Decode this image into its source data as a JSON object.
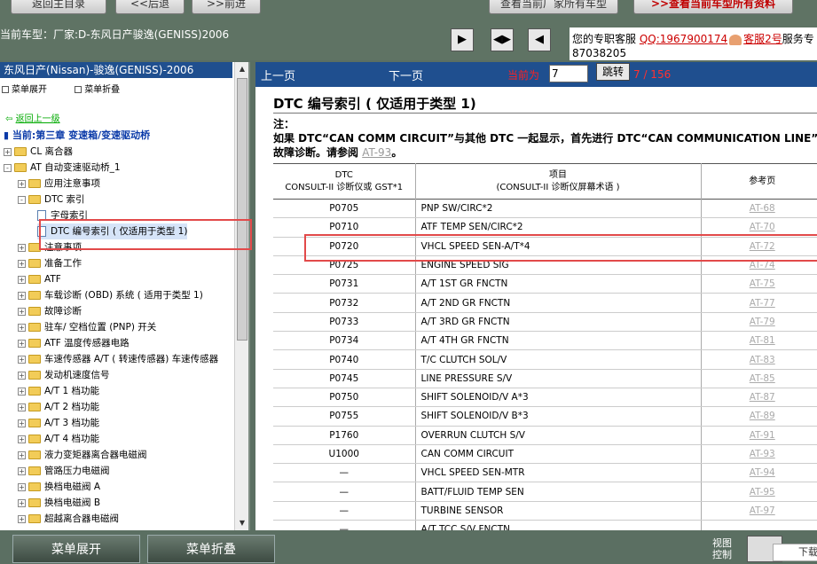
{
  "topbar": {
    "buttons": [
      "返回主目录",
      "<<后退",
      ">>前进",
      "查看当前厂家所有车型",
      ">>查看当前车型所有资料"
    ],
    "current_model": "当前车型：厂家:D-东风日产骏逸(GENISS)2006",
    "nav_icons": [
      "panel-right-icon",
      "panel-split-icon",
      "panel-left-icon"
    ],
    "service_text": "您的专职客服",
    "qq": "QQ:1967900174",
    "service2": "客服2号",
    "service_suffix": "服务专",
    "phone": "87038205"
  },
  "sidebar": {
    "title": "东风日产(Nissan)-骏逸(GENISS)-2006",
    "expand_all": "菜单展开",
    "collapse_all": "菜单折叠",
    "back_up": "返回上一级",
    "current_chapter": "当前:第三章 变速箱/变速驱动桥",
    "tree": [
      {
        "label": "CL 离合器",
        "level": 0,
        "exp": "+"
      },
      {
        "label": "AT 自动变速驱动桥_1",
        "level": 0,
        "exp": "-"
      },
      {
        "label": "应用注意事项",
        "level": 1,
        "exp": "+"
      },
      {
        "label": "DTC 索引",
        "level": 1,
        "exp": "-"
      },
      {
        "label": "字母索引",
        "level": 2,
        "exp": ""
      },
      {
        "label": "DTC 编号索引 ( 仅适用于类型 1)",
        "level": 2,
        "exp": "",
        "selected": true
      },
      {
        "label": "注意事项",
        "level": 1,
        "exp": "+"
      },
      {
        "label": "准备工作",
        "level": 1,
        "exp": "+"
      },
      {
        "label": "ATF",
        "level": 1,
        "exp": "+"
      },
      {
        "label": "车载诊断 (OBD) 系统 ( 适用于类型 1)",
        "level": 1,
        "exp": "+"
      },
      {
        "label": "故障诊断",
        "level": 1,
        "exp": "+"
      },
      {
        "label": "驻车/ 空档位置 (PNP) 开关",
        "level": 1,
        "exp": "+"
      },
      {
        "label": "ATF 温度传感器电路",
        "level": 1,
        "exp": "+"
      },
      {
        "label": "车速传感器 A/T ( 转速传感器) 车速传感器",
        "level": 1,
        "exp": "+"
      },
      {
        "label": "发动机速度信号",
        "level": 1,
        "exp": "+"
      },
      {
        "label": "A/T 1 档功能",
        "level": 1,
        "exp": "+"
      },
      {
        "label": "A/T 2 档功能",
        "level": 1,
        "exp": "+"
      },
      {
        "label": "A/T 3 档功能",
        "level": 1,
        "exp": "+"
      },
      {
        "label": "A/T 4 档功能",
        "level": 1,
        "exp": "+"
      },
      {
        "label": "液力变矩器离合器电磁阀",
        "level": 1,
        "exp": "+"
      },
      {
        "label": "管路压力电磁阀",
        "level": 1,
        "exp": "+"
      },
      {
        "label": "换档电磁阀 A",
        "level": 1,
        "exp": "+"
      },
      {
        "label": "换档电磁阀 B",
        "level": 1,
        "exp": "+"
      },
      {
        "label": "超越离合器电磁阀",
        "level": 1,
        "exp": "+"
      }
    ]
  },
  "main": {
    "prev": "上一页",
    "next": "下一页",
    "current_label": "当前为",
    "page_input": "7",
    "jump": "跳转",
    "page_count": "7 / 156",
    "title": "DTC 编号索引 ( 仅适用于类型 1)",
    "note_label": "注：",
    "note_line1": "如果 DTC“CAN COMM CIRCUIT”与其他 DTC 一起显示，首先进行 DTC“CAN COMMUNICATION LINE”",
    "note_line2_pre": "故障诊断。请参阅",
    "note_link": "AT-93",
    "note_line2_post": "。",
    "table": {
      "col1_header_top": "DTC",
      "col1_header_bottom": "CONSULT-II 诊断仪或 GST*1",
      "col2_header_top": "项目",
      "col2_header_bottom": "(CONSULT-II 诊断仪屏幕术语 )",
      "col3_header": "参考页",
      "rows": [
        [
          "P0705",
          "PNP SW/CIRC*2",
          "AT-68"
        ],
        [
          "P0710",
          "ATF TEMP SEN/CIRC*2",
          "AT-70"
        ],
        [
          "P0720",
          "VHCL SPEED SEN-A/T*4",
          "AT-72"
        ],
        [
          "P0725",
          "ENGINE SPEED SIG",
          "AT-74"
        ],
        [
          "P0731",
          "A/T 1ST GR FNCTN",
          "AT-75"
        ],
        [
          "P0732",
          "A/T 2ND GR FNCTN",
          "AT-77"
        ],
        [
          "P0733",
          "A/T 3RD GR FNCTN",
          "AT-79"
        ],
        [
          "P0734",
          "A/T 4TH GR FNCTN",
          "AT-81"
        ],
        [
          "P0740",
          "T/C CLUTCH SOL/V",
          "AT-83"
        ],
        [
          "P0745",
          "LINE PRESSURE S/V",
          "AT-85"
        ],
        [
          "P0750",
          "SHIFT SOLENOID/V A*3",
          "AT-87"
        ],
        [
          "P0755",
          "SHIFT SOLENOID/V B*3",
          "AT-89"
        ],
        [
          "P1760",
          "OVERRUN CLUTCH S/V",
          "AT-91"
        ],
        [
          "U1000",
          "CAN COMM CIRCUIT",
          "AT-93"
        ],
        [
          "—",
          "VHCL SPEED SEN-MTR",
          "AT-94"
        ],
        [
          "—",
          "BATT/FLUID TEMP SEN",
          "AT-95"
        ],
        [
          "—",
          "TURBINE SENSOR",
          "AT-97"
        ],
        [
          "—",
          "A/T TCC S/V FNCTN",
          ""
        ]
      ]
    }
  },
  "bottombar": {
    "expand": "菜单展开",
    "collapse": "菜单折叠",
    "view_line1": "视图",
    "view_line2": "控制",
    "download": "下载"
  },
  "colors": {
    "highlight": "#e24a4a",
    "header_blue": "#1f4f8f",
    "page_red": "#ff3030"
  }
}
